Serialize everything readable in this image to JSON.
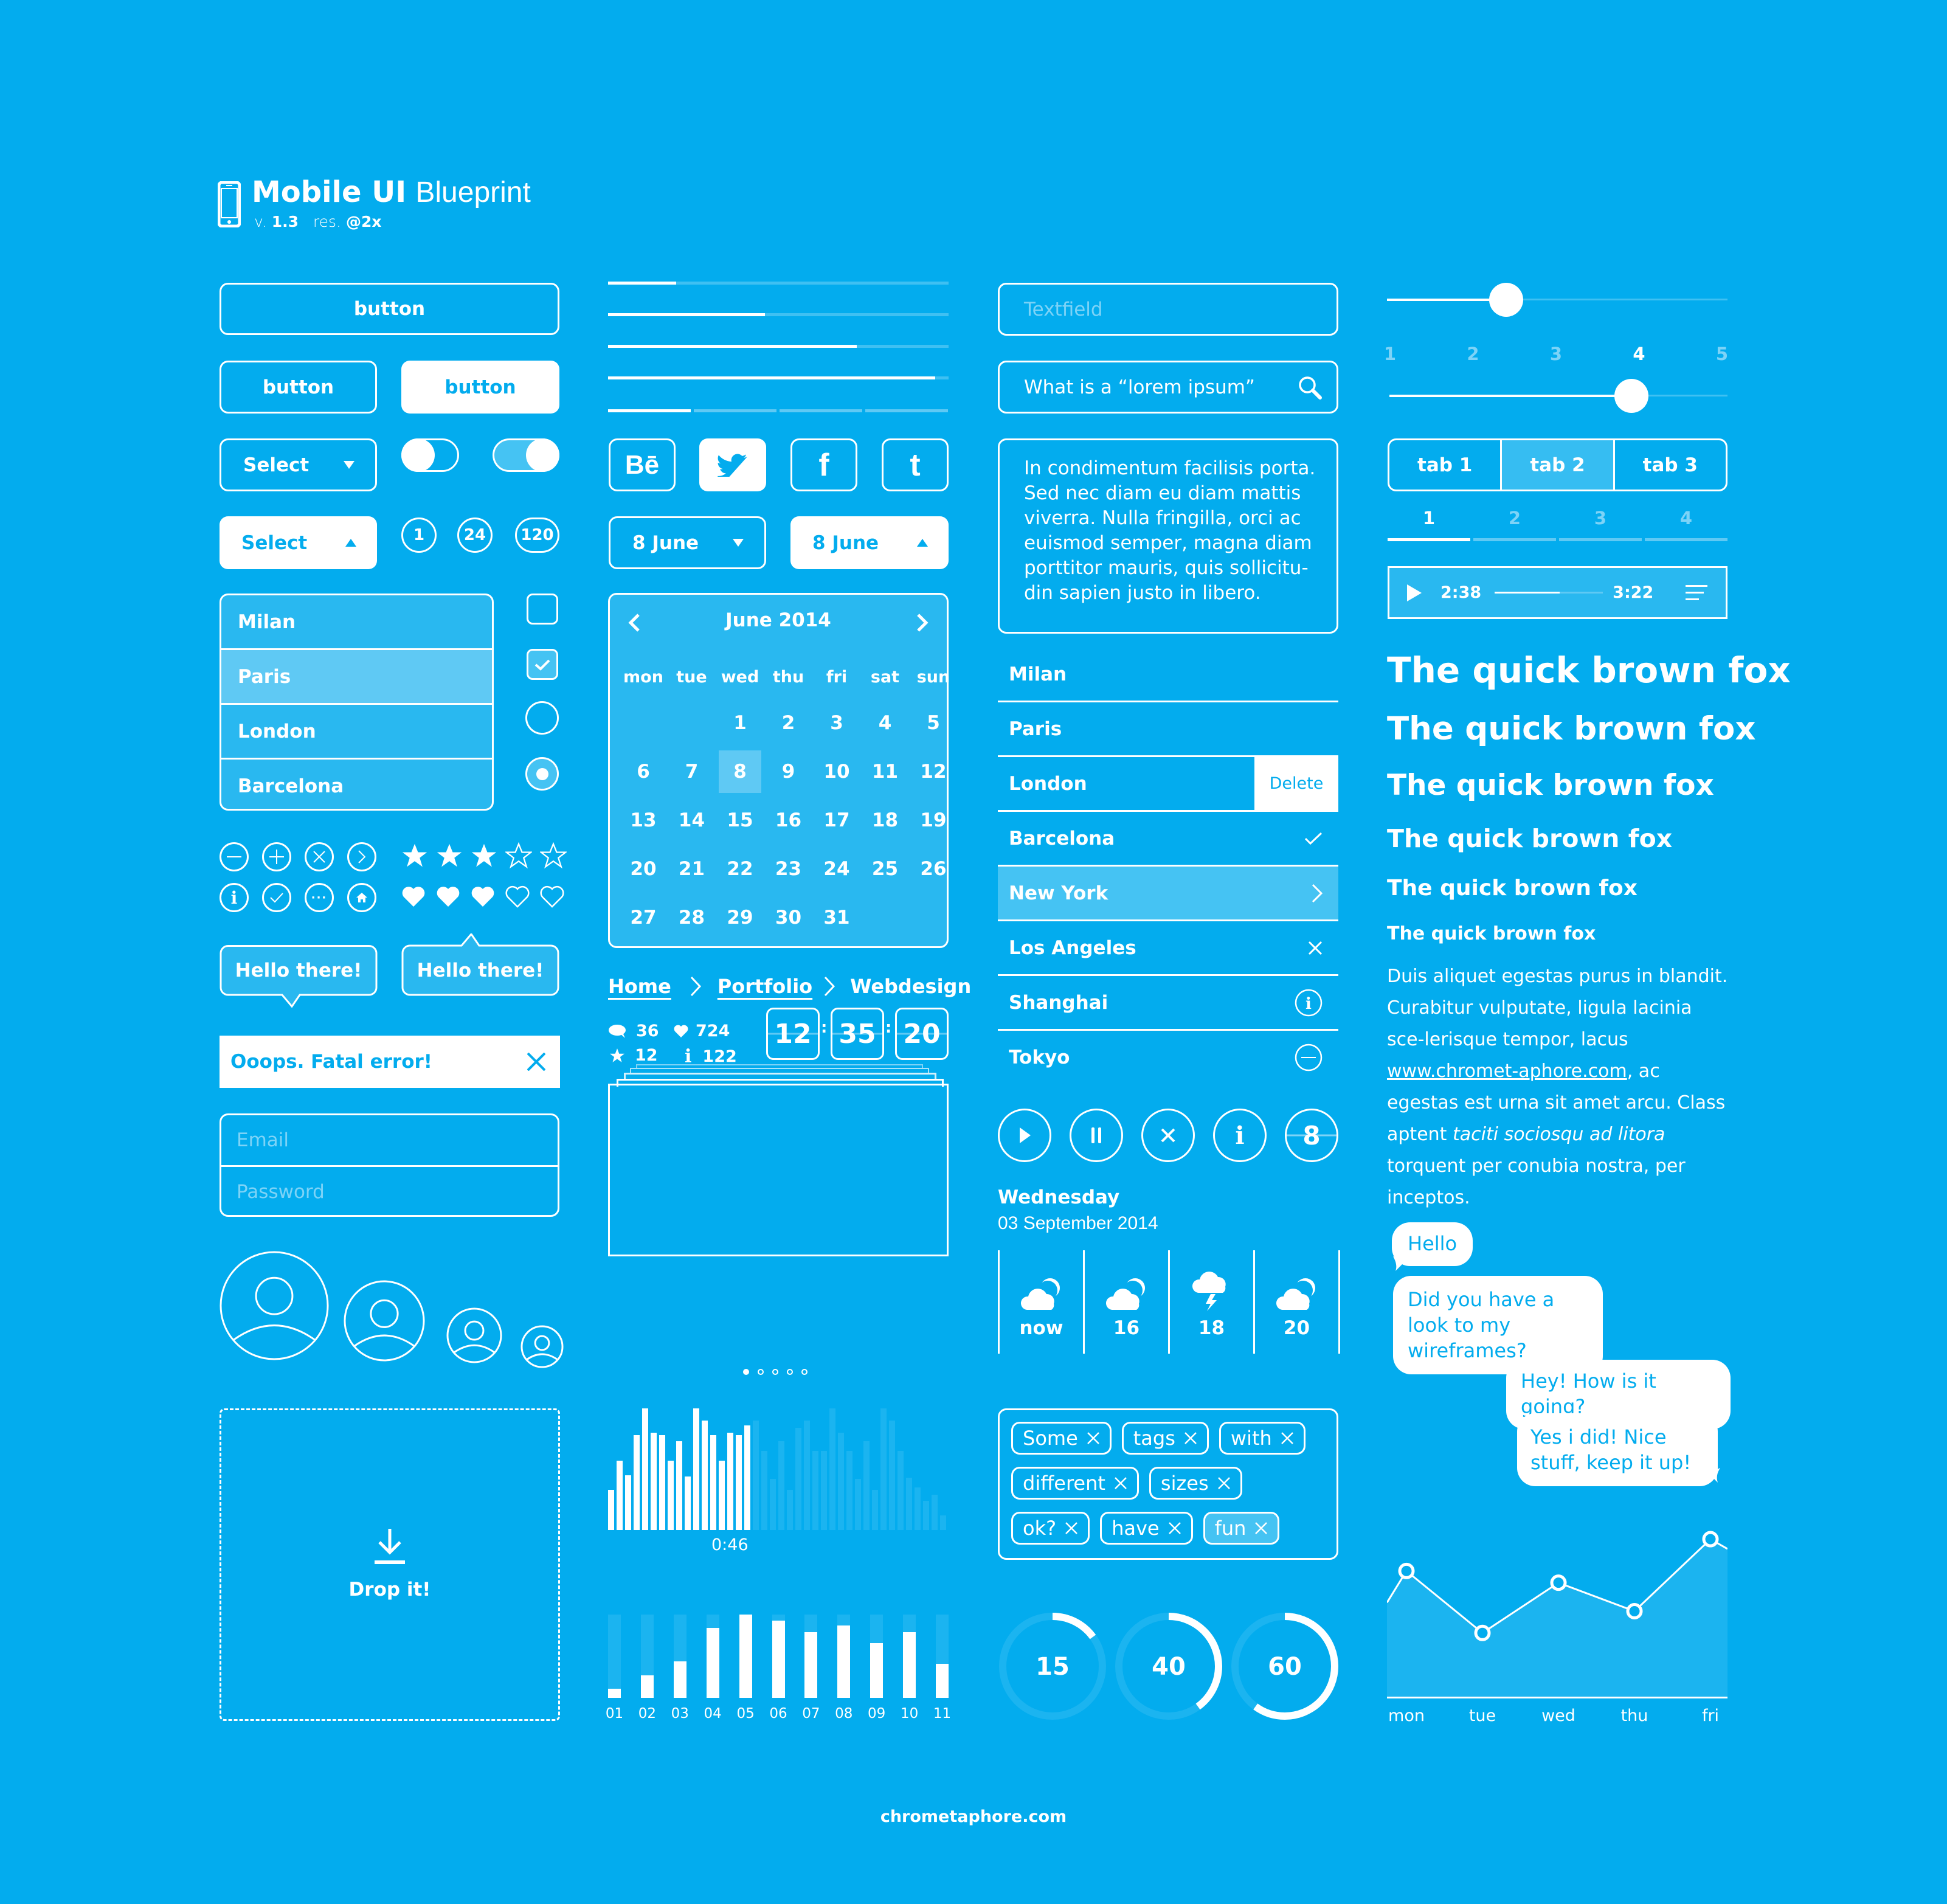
{
  "header": {
    "title_bold": "Mobile UI",
    "title_light": "Blueprint",
    "version_label": "v.",
    "version": "1.3",
    "res_label": "res.",
    "res": "@2x",
    "icon": "smartphone-icon"
  },
  "buttons": {
    "wide": "button",
    "outline": "button",
    "filled": "button"
  },
  "selects": {
    "closed": "Select",
    "open": "Select"
  },
  "toggles": [
    {
      "state": "off"
    },
    {
      "state": "on"
    }
  ],
  "badges": [
    "1",
    "24",
    "120"
  ],
  "dropdown_list": {
    "items": [
      "Milan",
      "Paris",
      "London",
      "Barcelona"
    ],
    "selected": "Paris"
  },
  "checkboxes": [
    {
      "checked": false
    },
    {
      "checked": true
    }
  ],
  "radios": [
    {
      "checked": false
    },
    {
      "checked": true
    }
  ],
  "round_icons_row1": [
    "minus-circle-icon",
    "plus-circle-icon",
    "close-circle-icon",
    "chevron-right-circle-icon"
  ],
  "round_icons_row2": [
    "info-circle-icon",
    "check-circle-icon",
    "more-circle-icon",
    "home-circle-icon"
  ],
  "rating": {
    "stars": 3,
    "stars_max": 5,
    "hearts": 3,
    "hearts_max": 5
  },
  "tooltips": [
    "Hello there!",
    "Hello there!"
  ],
  "error": {
    "text": "Ooops. Fatal error!"
  },
  "login": {
    "email_placeholder": "Email",
    "password_placeholder": "Password"
  },
  "avatars": [
    "avatar-xl",
    "avatar-l",
    "avatar-m",
    "avatar-s"
  ],
  "dropzone": {
    "label": "Drop it!"
  },
  "progress_bars": [
    0.2,
    0.46,
    0.73,
    0.96
  ],
  "step_progress": {
    "steps": 4,
    "completed": 1
  },
  "social": [
    "behance-icon",
    "twitter-icon",
    "facebook-icon",
    "tumblr-icon"
  ],
  "date_pickers": [
    {
      "label": "8 June",
      "open": false
    },
    {
      "label": "8 June",
      "open": true
    }
  ],
  "calendar": {
    "title": "June 2014",
    "weekdays": [
      "mon",
      "tue",
      "wed",
      "thu",
      "fri",
      "sat",
      "sun"
    ],
    "first_weekday_index": 2,
    "days": 31,
    "selected": 8
  },
  "breadcrumb": [
    "Home",
    "Portfolio",
    "Webdesign"
  ],
  "stats": {
    "comments": "36",
    "likes": "724",
    "stars": "12",
    "info": "122"
  },
  "clock": {
    "h": "12",
    "m": "35",
    "s": "20",
    "sep": ":"
  },
  "carousel": {
    "pages": 5,
    "active": 0
  },
  "audio_wave": {
    "time": "0:46",
    "played": [
      33,
      57,
      45,
      78,
      100,
      80,
      78,
      57,
      73,
      44,
      100,
      90,
      78,
      57,
      80,
      78,
      86
    ],
    "remaining": [
      90,
      65,
      42,
      73,
      33,
      84,
      90,
      65,
      65,
      100,
      80,
      65,
      42,
      73,
      33,
      100,
      90,
      65,
      43,
      35,
      24,
      29,
      12
    ]
  },
  "bar_chart": {
    "categories": [
      "01",
      "02",
      "03",
      "04",
      "05",
      "06",
      "07",
      "08",
      "09",
      "10",
      "11"
    ],
    "values": [
      11,
      27,
      44,
      84,
      100,
      93,
      79,
      87,
      66,
      79,
      41
    ]
  },
  "textfields": {
    "placeholder": "Textfield",
    "search_value": "What is a “lorem ipsum”"
  },
  "textarea": "In condimentum facilisis porta. Sed nec diam eu diam mattis viverra. Nulla fringilla, orci ac euismod semper, magna diam porttitor mauris, quis sollicitu-din sapien justo in libero.",
  "list": {
    "items": [
      {
        "label": "Milan",
        "accessory": ""
      },
      {
        "label": "Paris",
        "accessory": ""
      },
      {
        "label": "London",
        "accessory": "delete"
      },
      {
        "label": "Barcelona",
        "accessory": "check"
      },
      {
        "label": "New York",
        "accessory": "chevron",
        "highlighted": true
      },
      {
        "label": "Los Angeles",
        "accessory": "close"
      },
      {
        "label": "Shanghai",
        "accessory": "info"
      },
      {
        "label": "Tokyo",
        "accessory": "minus"
      }
    ],
    "delete_label": "Delete"
  },
  "media_buttons": [
    "play-icon",
    "pause-icon",
    "close-icon",
    "info-icon",
    "8"
  ],
  "weather": {
    "day": "Wednesday",
    "date": "03 September 2014",
    "slots": [
      {
        "label": "now",
        "icon": "partly-cloudy-icon"
      },
      {
        "label": "16",
        "icon": "partly-cloudy-icon"
      },
      {
        "label": "18",
        "icon": "thunderstorm-icon"
      },
      {
        "label": "20",
        "icon": "partly-cloudy-icon"
      }
    ]
  },
  "tags": [
    {
      "label": "Some"
    },
    {
      "label": "tags"
    },
    {
      "label": "with"
    },
    {
      "label": "different"
    },
    {
      "label": "sizes"
    },
    {
      "label": "ok?"
    },
    {
      "label": "have"
    },
    {
      "label": "fun",
      "active": true
    }
  ],
  "progress_rings": [
    15,
    40,
    60
  ],
  "slider": {
    "value": 0.35
  },
  "step_slider": {
    "labels": [
      "1",
      "2",
      "3",
      "4",
      "5"
    ],
    "value": "4"
  },
  "tabs": {
    "items": [
      "tab 1",
      "tab 2",
      "tab 3"
    ],
    "active": 1
  },
  "page_tabs": {
    "items": [
      "1",
      "2",
      "3",
      "4"
    ],
    "active": 0
  },
  "player": {
    "elapsed": "2:38",
    "total": "3:22",
    "progress": 0.6
  },
  "typography": {
    "heading": "The quick brown fox",
    "body_1": "Duis aliquet egestas purus in blandit. Curabitur vulputate, ligula lacinia sce-lerisque tempor, lacus ",
    "link": "www.chromet-aphore.com",
    "body_2": ", ac egestas est urna sit amet arcu. Class aptent ",
    "italic": "taciti sociosqu ad litora",
    "body_3": " torquent per conubia nostra, per inceptos."
  },
  "chat": [
    {
      "text": "Hello",
      "side": "left"
    },
    {
      "text": "Did you have a look to my wireframes?",
      "side": "left"
    },
    {
      "text": "Hey! How is  it going?",
      "side": "right"
    },
    {
      "text": "Yes i did! Nice stuff, keep it up!",
      "side": "right"
    }
  ],
  "chart_data": {
    "type": "area",
    "categories": [
      "mon",
      "tue",
      "wed",
      "thu",
      "fri"
    ],
    "values": [
      75,
      38,
      68,
      51,
      94
    ],
    "ylim": [
      0,
      100
    ],
    "title": "",
    "xlabel": "",
    "ylabel": "",
    "grid": false
  },
  "footer": "chrometaphore.com"
}
